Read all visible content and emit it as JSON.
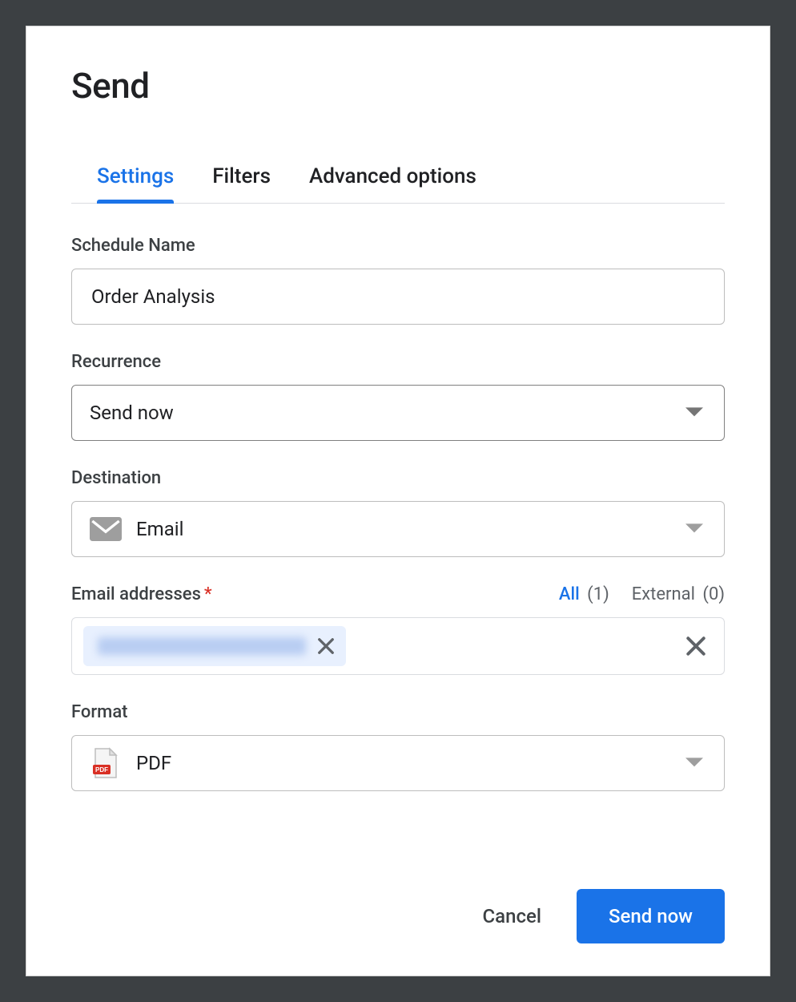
{
  "dialog": {
    "title": "Send",
    "tabs": [
      {
        "label": "Settings",
        "active": true
      },
      {
        "label": "Filters",
        "active": false
      },
      {
        "label": "Advanced options",
        "active": false
      }
    ],
    "fields": {
      "schedule_name": {
        "label": "Schedule Name",
        "value": "Order Analysis"
      },
      "recurrence": {
        "label": "Recurrence",
        "value": "Send now"
      },
      "destination": {
        "label": "Destination",
        "value": "Email",
        "icon": "email-icon"
      },
      "email_addresses": {
        "label": "Email addresses",
        "required": true,
        "all_label": "All",
        "all_count": 1,
        "external_label": "External",
        "external_count": 0,
        "chips": [
          {
            "text_redacted": true
          }
        ]
      },
      "format": {
        "label": "Format",
        "value": "PDF",
        "icon": "pdf-icon"
      }
    },
    "footer": {
      "cancel": "Cancel",
      "primary": "Send now"
    }
  }
}
